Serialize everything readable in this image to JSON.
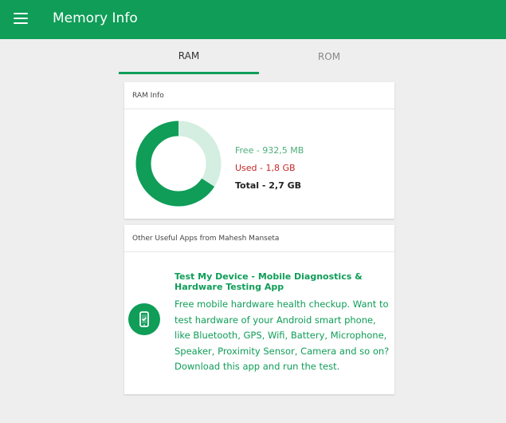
{
  "appbar": {
    "title": "Memory Info",
    "menu_icon": "hamburger-menu-icon",
    "color": "#0f9d58"
  },
  "tabs": [
    {
      "label": "RAM",
      "active": true
    },
    {
      "label": "ROM",
      "active": false
    }
  ],
  "ram_card": {
    "header": "RAM Info",
    "free_label": "Free - 932,5 MB",
    "used_label": "Used - 1,8 GB",
    "total_label": "Total - 2,7 GB",
    "used_fraction": 0.66,
    "used_color": "#0f9d58",
    "free_color": "#d4eee1"
  },
  "apps_card": {
    "header": "Other Useful Apps from Mahesh Manseta",
    "app": {
      "icon": "phone-check-icon",
      "title": "Test My Device - Mobile Diagnostics & Hardware Testing App",
      "description": "Free mobile hardware health checkup. Want to test hardware of your Android smart phone, like Bluetooth, GPS, Wifi, Battery, Microphone, Speaker, Proximity Sensor, Camera and so on? Download this app and run the test."
    }
  }
}
